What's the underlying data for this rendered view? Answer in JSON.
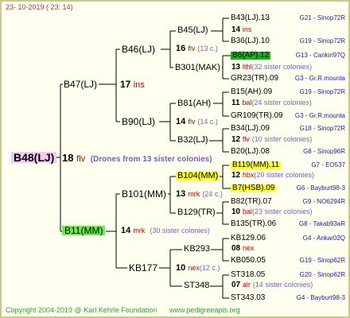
{
  "header": {
    "date": "23- 10-2019 ( 23: 14)"
  },
  "footer": {
    "copyright": "Copyright 2004-2019 @ Karl Kehrle Foundation",
    "website": "www.pedigreeapis.org"
  },
  "root": {
    "name": "B48(LJ)",
    "num": "18",
    "tag": "flv",
    "note": "(Drones from 13 sister colonies)"
  },
  "gen2": [
    {
      "name": "B47(LJ)",
      "num": "17",
      "tag": "ins",
      "note": ""
    },
    {
      "name": "B11(MM)",
      "num": "14",
      "tag": "mrk",
      "note": "(30 sister colonies)"
    }
  ],
  "gen3": [
    {
      "name": "B46(LJ)",
      "num": "16",
      "tag": "flv",
      "note": "(13 c.)"
    },
    {
      "name": "B90(LJ)",
      "num": "14",
      "tag": "flv",
      "note": "(14 c.)"
    },
    {
      "name": "B101(MM)",
      "num": "13",
      "tag": "mrk",
      "note": "(24 c.)"
    },
    {
      "name": "KB177",
      "num": "10",
      "tag": "nex",
      "note": "(12 c.)"
    }
  ],
  "gen4": [
    {
      "name": "B45(LJ)",
      "num": "14",
      "tag": "ins",
      "note": ""
    },
    {
      "name": "B301(MAK)",
      "num": "13",
      "tag": "lthl",
      "note": "(32 sister colonies)"
    },
    {
      "name": "B81(AH)",
      "num": "11",
      "tag": "bal",
      "note": "(24 sister colonies)"
    },
    {
      "name": "B32(LJ)",
      "num": "12",
      "tag": "flv",
      "note": "(10 sister colonies)"
    },
    {
      "name": "B104(MM)",
      "num": "12",
      "tag": "hbx",
      "note": "(20 sister colonies)"
    },
    {
      "name": "B129(TR)",
      "num": "10",
      "tag": "bal",
      "note": "(23 sister colonies)"
    },
    {
      "name": "KB293",
      "num": "08",
      "tag": "nex",
      "note": ""
    },
    {
      "name": "ST348",
      "num": "07",
      "tag": "alr",
      "note": "(14 sister colonies)"
    }
  ],
  "gen5": [
    {
      "name": "B43(LJ).13",
      "origin": "G21 - Sinop72R"
    },
    {
      "name": "B36(LJ).10",
      "origin": "G19 - Sinop72R"
    },
    {
      "name": "B6(AP).12",
      "origin": "G13 - Cankiri97Q"
    },
    {
      "name": "GR23(TR).09",
      "origin": "G3 - Gr.R.mounta"
    },
    {
      "name": "B15(AH).09",
      "origin": "G19 - Sinop72R"
    },
    {
      "name": "GR109(TR).09",
      "origin": "G3 - Gr.R.mounta"
    },
    {
      "name": "B34(LJ).09",
      "origin": "G18 - Sinop72R"
    },
    {
      "name": "B20(LJ).08",
      "origin": "G8 - Sinop96R"
    },
    {
      "name": "B119(MM).11",
      "origin": "G7 - EO537"
    },
    {
      "name": "B7(HSB).09",
      "origin": "G6 - Bayburt98-3"
    },
    {
      "name": "B82(TR).07",
      "origin": "G9 - NO6294R"
    },
    {
      "name": "B135(TR).06",
      "origin": "G8 - Takab93aR"
    },
    {
      "name": "KB129.06",
      "origin": "G4 - Ankar02Q"
    },
    {
      "name": "KB050.05",
      "origin": "G19 - Sinop62R"
    },
    {
      "name": "ST318.05",
      "origin": "G20 - Sinop62R"
    },
    {
      "name": "ST343.03",
      "origin": "G4 - Bayburt98-3"
    }
  ]
}
